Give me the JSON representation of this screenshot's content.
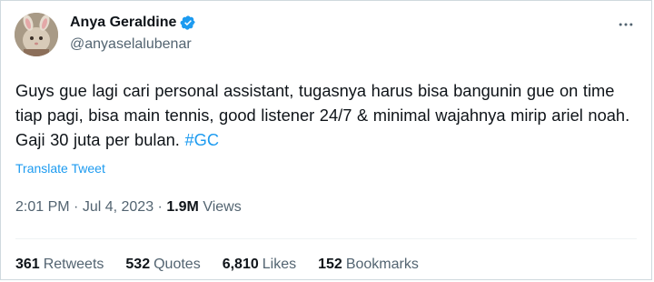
{
  "user": {
    "display_name": "Anya Geraldine",
    "handle": "@anyaselalubenar",
    "verified": true
  },
  "tweet": {
    "text_parts": [
      "Guys gue lagi cari personal assistant, tugasnya harus bisa bangunin gue on time tiap pagi, bisa main tennis, good listener 24/7 & minimal wajahnya mirip ariel noah. Gaji 30 juta per bulan. "
    ],
    "hashtag": "#GC",
    "translate_label": "Translate Tweet"
  },
  "meta": {
    "time": "2:01 PM",
    "separator": " · ",
    "date": "Jul 4, 2023",
    "views_count": "1.9M",
    "views_label": " Views"
  },
  "stats": [
    {
      "count": "361",
      "label": "Retweets"
    },
    {
      "count": "532",
      "label": "Quotes"
    },
    {
      "count": "6,810",
      "label": "Likes"
    },
    {
      "count": "152",
      "label": "Bookmarks"
    }
  ],
  "colors": {
    "accent": "#1d9bf0",
    "secondary_text": "#536471",
    "primary_text": "#0f1419",
    "border": "#cfd9de"
  },
  "icons": {
    "verified": "verified-badge-icon",
    "more": "more-dots-icon"
  }
}
